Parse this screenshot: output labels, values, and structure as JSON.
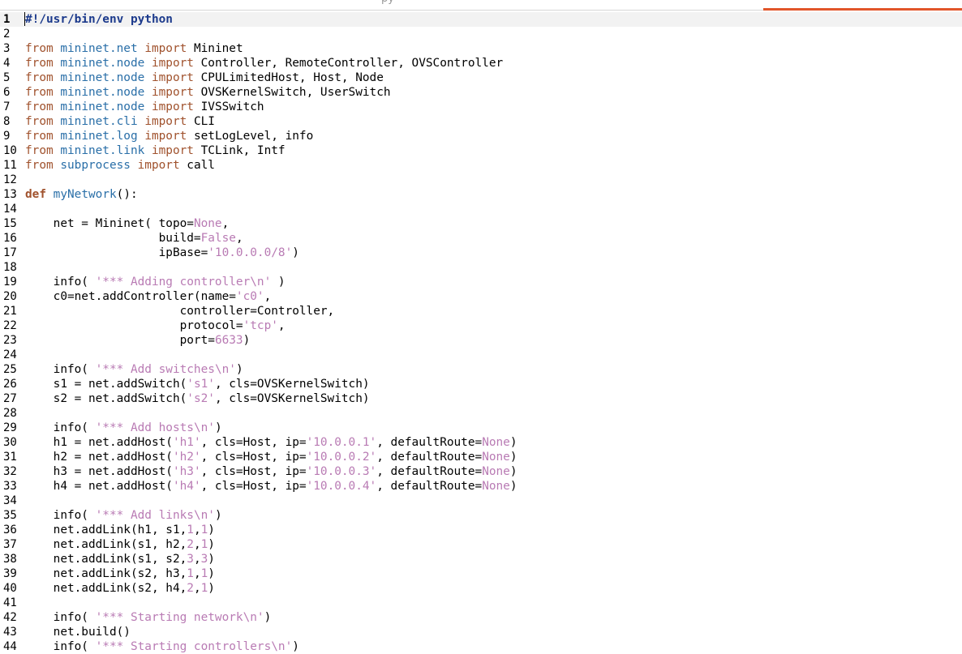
{
  "colors": {
    "keyword": "#a0522d",
    "module": "#2a6fa8",
    "string": "#b97bb4",
    "number": "#b97bb4",
    "constant": "#b97bb4",
    "plain": "#000000",
    "bold_blue": "#1c3a8c",
    "accent_bar": "#e1552a"
  },
  "window": {
    "title_fragment": "py"
  },
  "lines": [
    {
      "n": "1",
      "tokens": [
        {
          "t": "#!/usr/bin/env python",
          "k": "shebang"
        }
      ]
    },
    {
      "n": "2",
      "tokens": []
    },
    {
      "n": "3",
      "tokens": [
        {
          "t": "from",
          "k": "keyword"
        },
        {
          "t": " "
        },
        {
          "t": "mininet.net",
          "k": "module"
        },
        {
          "t": " "
        },
        {
          "t": "import",
          "k": "keyword"
        },
        {
          "t": " Mininet"
        }
      ]
    },
    {
      "n": "4",
      "tokens": [
        {
          "t": "from",
          "k": "keyword"
        },
        {
          "t": " "
        },
        {
          "t": "mininet.node",
          "k": "module"
        },
        {
          "t": " "
        },
        {
          "t": "import",
          "k": "keyword"
        },
        {
          "t": " Controller, RemoteController, OVSController"
        }
      ]
    },
    {
      "n": "5",
      "tokens": [
        {
          "t": "from",
          "k": "keyword"
        },
        {
          "t": " "
        },
        {
          "t": "mininet.node",
          "k": "module"
        },
        {
          "t": " "
        },
        {
          "t": "import",
          "k": "keyword"
        },
        {
          "t": " CPULimitedHost, Host, Node"
        }
      ]
    },
    {
      "n": "6",
      "tokens": [
        {
          "t": "from",
          "k": "keyword"
        },
        {
          "t": " "
        },
        {
          "t": "mininet.node",
          "k": "module"
        },
        {
          "t": " "
        },
        {
          "t": "import",
          "k": "keyword"
        },
        {
          "t": " OVSKernelSwitch, UserSwitch"
        }
      ]
    },
    {
      "n": "7",
      "tokens": [
        {
          "t": "from",
          "k": "keyword"
        },
        {
          "t": " "
        },
        {
          "t": "mininet.node",
          "k": "module"
        },
        {
          "t": " "
        },
        {
          "t": "import",
          "k": "keyword"
        },
        {
          "t": " IVSSwitch"
        }
      ]
    },
    {
      "n": "8",
      "tokens": [
        {
          "t": "from",
          "k": "keyword"
        },
        {
          "t": " "
        },
        {
          "t": "mininet.cli",
          "k": "module"
        },
        {
          "t": " "
        },
        {
          "t": "import",
          "k": "keyword"
        },
        {
          "t": " CLI"
        }
      ]
    },
    {
      "n": "9",
      "tokens": [
        {
          "t": "from",
          "k": "keyword"
        },
        {
          "t": " "
        },
        {
          "t": "mininet.log",
          "k": "module"
        },
        {
          "t": " "
        },
        {
          "t": "import",
          "k": "keyword"
        },
        {
          "t": " setLogLevel, info"
        }
      ]
    },
    {
      "n": "10",
      "tokens": [
        {
          "t": "from",
          "k": "keyword"
        },
        {
          "t": " "
        },
        {
          "t": "mininet.link",
          "k": "module"
        },
        {
          "t": " "
        },
        {
          "t": "import",
          "k": "keyword"
        },
        {
          "t": " TCLink, Intf"
        }
      ]
    },
    {
      "n": "11",
      "tokens": [
        {
          "t": "from",
          "k": "keyword"
        },
        {
          "t": " "
        },
        {
          "t": "subprocess",
          "k": "module"
        },
        {
          "t": " "
        },
        {
          "t": "import",
          "k": "keyword"
        },
        {
          "t": " call"
        }
      ]
    },
    {
      "n": "12",
      "tokens": []
    },
    {
      "n": "13",
      "tokens": [
        {
          "t": "def",
          "k": "def"
        },
        {
          "t": " "
        },
        {
          "t": "myNetwork",
          "k": "module"
        },
        {
          "t": "():"
        }
      ]
    },
    {
      "n": "14",
      "tokens": []
    },
    {
      "n": "15",
      "tokens": [
        {
          "t": "    net = Mininet( topo="
        },
        {
          "t": "None",
          "k": "constant"
        },
        {
          "t": ","
        }
      ]
    },
    {
      "n": "16",
      "tokens": [
        {
          "t": "                   build="
        },
        {
          "t": "False",
          "k": "constant"
        },
        {
          "t": ","
        }
      ]
    },
    {
      "n": "17",
      "tokens": [
        {
          "t": "                   ipBase="
        },
        {
          "t": "'10.0.0.0/8'",
          "k": "string"
        },
        {
          "t": ")"
        }
      ]
    },
    {
      "n": "18",
      "tokens": []
    },
    {
      "n": "19",
      "tokens": [
        {
          "t": "    info( "
        },
        {
          "t": "'*** Adding controller",
          "k": "string"
        },
        {
          "t": "\\n",
          "k": "escape"
        },
        {
          "t": "'",
          "k": "string"
        },
        {
          "t": " )"
        }
      ]
    },
    {
      "n": "20",
      "tokens": [
        {
          "t": "    c0=net.addController(name="
        },
        {
          "t": "'c0'",
          "k": "string"
        },
        {
          "t": ","
        }
      ]
    },
    {
      "n": "21",
      "tokens": [
        {
          "t": "                      controller=Controller,"
        }
      ]
    },
    {
      "n": "22",
      "tokens": [
        {
          "t": "                      protocol="
        },
        {
          "t": "'tcp'",
          "k": "string"
        },
        {
          "t": ","
        }
      ]
    },
    {
      "n": "23",
      "tokens": [
        {
          "t": "                      port="
        },
        {
          "t": "6633",
          "k": "number"
        },
        {
          "t": ")"
        }
      ]
    },
    {
      "n": "24",
      "tokens": []
    },
    {
      "n": "25",
      "tokens": [
        {
          "t": "    info( "
        },
        {
          "t": "'*** Add switches",
          "k": "string"
        },
        {
          "t": "\\n",
          "k": "escape"
        },
        {
          "t": "'",
          "k": "string"
        },
        {
          "t": ")"
        }
      ]
    },
    {
      "n": "26",
      "tokens": [
        {
          "t": "    s1 = net.addSwitch("
        },
        {
          "t": "'s1'",
          "k": "string"
        },
        {
          "t": ", cls=OVSKernelSwitch)"
        }
      ]
    },
    {
      "n": "27",
      "tokens": [
        {
          "t": "    s2 = net.addSwitch("
        },
        {
          "t": "'s2'",
          "k": "string"
        },
        {
          "t": ", cls=OVSKernelSwitch)"
        }
      ]
    },
    {
      "n": "28",
      "tokens": []
    },
    {
      "n": "29",
      "tokens": [
        {
          "t": "    info( "
        },
        {
          "t": "'*** Add hosts",
          "k": "string"
        },
        {
          "t": "\\n",
          "k": "escape"
        },
        {
          "t": "'",
          "k": "string"
        },
        {
          "t": ")"
        }
      ]
    },
    {
      "n": "30",
      "tokens": [
        {
          "t": "    h1 = net.addHost("
        },
        {
          "t": "'h1'",
          "k": "string"
        },
        {
          "t": ", cls=Host, ip="
        },
        {
          "t": "'10.0.0.1'",
          "k": "string"
        },
        {
          "t": ", defaultRoute="
        },
        {
          "t": "None",
          "k": "constant"
        },
        {
          "t": ")"
        }
      ]
    },
    {
      "n": "31",
      "tokens": [
        {
          "t": "    h2 = net.addHost("
        },
        {
          "t": "'h2'",
          "k": "string"
        },
        {
          "t": ", cls=Host, ip="
        },
        {
          "t": "'10.0.0.2'",
          "k": "string"
        },
        {
          "t": ", defaultRoute="
        },
        {
          "t": "None",
          "k": "constant"
        },
        {
          "t": ")"
        }
      ]
    },
    {
      "n": "32",
      "tokens": [
        {
          "t": "    h3 = net.addHost("
        },
        {
          "t": "'h3'",
          "k": "string"
        },
        {
          "t": ", cls=Host, ip="
        },
        {
          "t": "'10.0.0.3'",
          "k": "string"
        },
        {
          "t": ", defaultRoute="
        },
        {
          "t": "None",
          "k": "constant"
        },
        {
          "t": ")"
        }
      ]
    },
    {
      "n": "33",
      "tokens": [
        {
          "t": "    h4 = net.addHost("
        },
        {
          "t": "'h4'",
          "k": "string"
        },
        {
          "t": ", cls=Host, ip="
        },
        {
          "t": "'10.0.0.4'",
          "k": "string"
        },
        {
          "t": ", defaultRoute="
        },
        {
          "t": "None",
          "k": "constant"
        },
        {
          "t": ")"
        }
      ]
    },
    {
      "n": "34",
      "tokens": []
    },
    {
      "n": "35",
      "tokens": [
        {
          "t": "    info( "
        },
        {
          "t": "'*** Add links",
          "k": "string"
        },
        {
          "t": "\\n",
          "k": "escape"
        },
        {
          "t": "'",
          "k": "string"
        },
        {
          "t": ")"
        }
      ]
    },
    {
      "n": "36",
      "tokens": [
        {
          "t": "    net.addLink(h1, s1,"
        },
        {
          "t": "1",
          "k": "number"
        },
        {
          "t": ","
        },
        {
          "t": "1",
          "k": "number"
        },
        {
          "t": ")"
        }
      ]
    },
    {
      "n": "37",
      "tokens": [
        {
          "t": "    net.addLink(s1, h2,"
        },
        {
          "t": "2",
          "k": "number"
        },
        {
          "t": ","
        },
        {
          "t": "1",
          "k": "number"
        },
        {
          "t": ")"
        }
      ]
    },
    {
      "n": "38",
      "tokens": [
        {
          "t": "    net.addLink(s1, s2,"
        },
        {
          "t": "3",
          "k": "number"
        },
        {
          "t": ","
        },
        {
          "t": "3",
          "k": "number"
        },
        {
          "t": ")"
        }
      ]
    },
    {
      "n": "39",
      "tokens": [
        {
          "t": "    net.addLink(s2, h3,"
        },
        {
          "t": "1",
          "k": "number"
        },
        {
          "t": ","
        },
        {
          "t": "1",
          "k": "number"
        },
        {
          "t": ")"
        }
      ]
    },
    {
      "n": "40",
      "tokens": [
        {
          "t": "    net.addLink(s2, h4,"
        },
        {
          "t": "2",
          "k": "number"
        },
        {
          "t": ","
        },
        {
          "t": "1",
          "k": "number"
        },
        {
          "t": ")"
        }
      ]
    },
    {
      "n": "41",
      "tokens": []
    },
    {
      "n": "42",
      "tokens": [
        {
          "t": "    info( "
        },
        {
          "t": "'*** Starting network",
          "k": "string"
        },
        {
          "t": "\\n",
          "k": "escape"
        },
        {
          "t": "'",
          "k": "string"
        },
        {
          "t": ")"
        }
      ]
    },
    {
      "n": "43",
      "tokens": [
        {
          "t": "    net.build()"
        }
      ]
    },
    {
      "n": "44",
      "tokens": [
        {
          "t": "    info( "
        },
        {
          "t": "'*** Starting controllers",
          "k": "string"
        },
        {
          "t": "\\n",
          "k": "escape"
        },
        {
          "t": "'",
          "k": "string"
        },
        {
          "t": ")"
        }
      ]
    }
  ]
}
